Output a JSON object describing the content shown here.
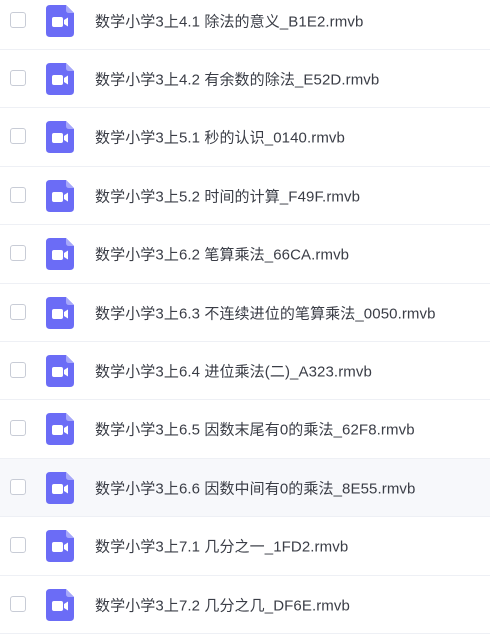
{
  "files": [
    {
      "name": "数学小学3上4.1 除法的意义_B1E2.rmvb",
      "icon": "video-file-icon",
      "hover": false
    },
    {
      "name": "数学小学3上4.2 有余数的除法_E52D.rmvb",
      "icon": "video-file-icon",
      "hover": false
    },
    {
      "name": "数学小学3上5.1 秒的认识_0140.rmvb",
      "icon": "video-file-icon",
      "hover": false
    },
    {
      "name": "数学小学3上5.2 时间的计算_F49F.rmvb",
      "icon": "video-file-icon",
      "hover": false
    },
    {
      "name": "数学小学3上6.2 笔算乘法_66CA.rmvb",
      "icon": "video-file-icon",
      "hover": false
    },
    {
      "name": "数学小学3上6.3 不连续进位的笔算乘法_0050.rmvb",
      "icon": "video-file-icon",
      "hover": false
    },
    {
      "name": "数学小学3上6.4 进位乘法(二)_A323.rmvb",
      "icon": "video-file-icon",
      "hover": false
    },
    {
      "name": "数学小学3上6.5 因数末尾有0的乘法_62F8.rmvb",
      "icon": "video-file-icon",
      "hover": false
    },
    {
      "name": "数学小学3上6.6 因数中间有0的乘法_8E55.rmvb",
      "icon": "video-file-icon",
      "hover": true
    },
    {
      "name": "数学小学3上7.1 几分之一_1FD2.rmvb",
      "icon": "video-file-icon",
      "hover": false
    },
    {
      "name": "数学小学3上7.2 几分之几_DF6E.rmvb",
      "icon": "video-file-icon",
      "hover": false
    }
  ],
  "colors": {
    "icon_fill": "#6b6cf6",
    "icon_fold": "#a7a8fa",
    "text": "#3a3d46",
    "divider": "#eef0f5",
    "hover_bg": "#f7f8fb"
  }
}
